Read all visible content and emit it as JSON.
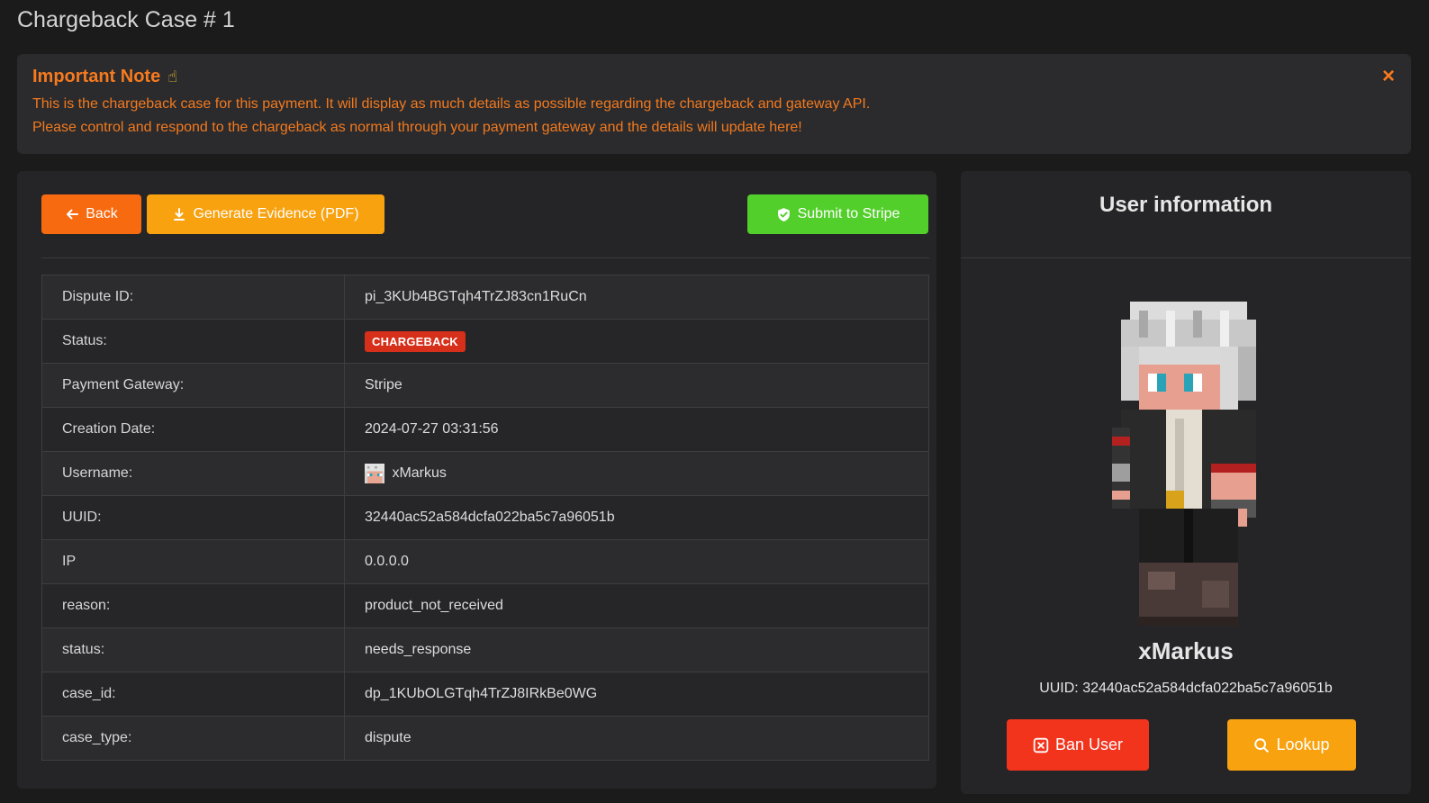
{
  "page": {
    "title": "Chargeback Case # 1"
  },
  "alert": {
    "title": "Important Note",
    "line1": "This is the chargeback case for this payment. It will display as much details as possible regarding the chargeback and gateway API.",
    "line2": "Please control and respond to the chargeback as normal through your payment gateway and the details will update here!",
    "close": "×"
  },
  "toolbar": {
    "back_label": "Back",
    "evidence_label": "Generate Evidence (PDF)",
    "submit_label": "Submit to Stripe"
  },
  "details": [
    {
      "label": "Dispute ID:",
      "value": "pi_3KUb4BGTqh4TrZJ83cn1RuCn"
    },
    {
      "label": "Status:",
      "value": "CHARGEBACK"
    },
    {
      "label": "Payment Gateway:",
      "value": "Stripe"
    },
    {
      "label": "Creation Date:",
      "value": "2024-07-27 03:31:56"
    },
    {
      "label": "Username:",
      "value": "xMarkus"
    },
    {
      "label": "UUID:",
      "value": "32440ac52a584dcfa022ba5c7a96051b"
    },
    {
      "label": "IP",
      "value": "0.0.0.0"
    },
    {
      "label": "reason:",
      "value": "product_not_received"
    },
    {
      "label": "status:",
      "value": "needs_response"
    },
    {
      "label": "case_id:",
      "value": "dp_1KUbOLGTqh4TrZJ8IRkBe0WG"
    },
    {
      "label": "case_type:",
      "value": "dispute"
    }
  ],
  "user": {
    "heading": "User information",
    "name": "xMarkus",
    "uuid_text": "UUID: 32440ac52a584dcfa022ba5c7a96051b",
    "ban_label": "Ban User",
    "lookup_label": "Lookup"
  },
  "colors": {
    "background": "#1b1b1c",
    "card": "#252527",
    "alert_text": "#f2791f",
    "back_button": "#f76a0f",
    "evidence_button": "#f8a210",
    "stripe_button": "#52cf2b",
    "status_badge": "#d62f1a",
    "ban_button": "#f2341d",
    "lookup_button": "#f8a210"
  },
  "icons": {
    "alert": "pointing-hand-icon",
    "close": "close-icon",
    "back": "arrow-left-icon",
    "evidence": "download-icon",
    "submit": "shield-check-icon",
    "ban": "x-square-icon",
    "lookup": "search-icon"
  }
}
